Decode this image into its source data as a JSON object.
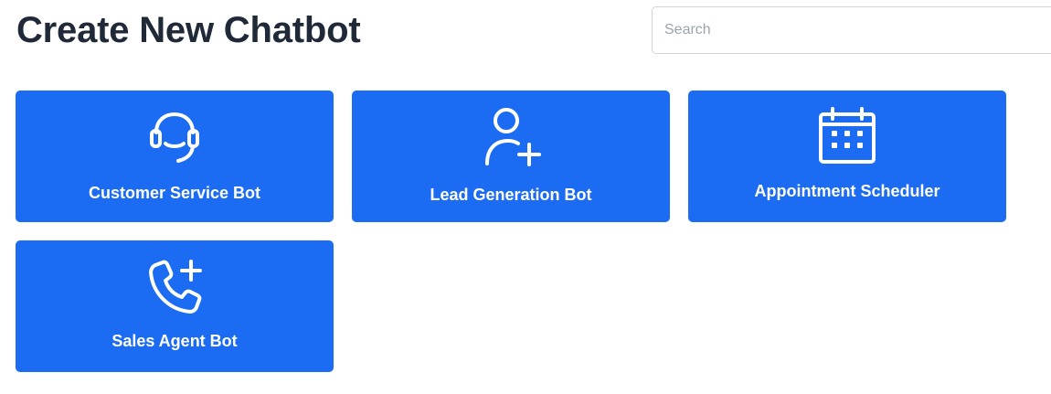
{
  "header": {
    "title": "Create New Chatbot"
  },
  "search": {
    "placeholder": "Search",
    "value": ""
  },
  "templates": [
    {
      "label": "Customer Service Bot",
      "icon": "headset-icon"
    },
    {
      "label": "Lead Generation Bot",
      "icon": "user-plus-icon"
    },
    {
      "label": "Appointment Scheduler",
      "icon": "calendar-icon"
    },
    {
      "label": "Sales Agent Bot",
      "icon": "phone-plus-icon"
    }
  ],
  "colors": {
    "card_background": "#1b6cf2",
    "card_text": "#ffffff",
    "title_text": "#1f2937"
  }
}
